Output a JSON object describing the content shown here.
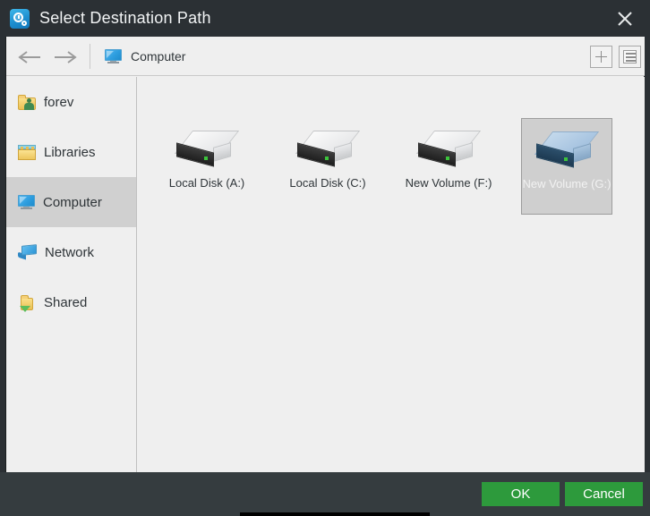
{
  "window": {
    "title": "Select Destination Path",
    "icon": "app-clock-icon",
    "close_icon": "close-icon",
    "accent_green": "#2d9a3c",
    "titlebar_color": "#2b3034",
    "panel_color": "#efefef"
  },
  "navbar": {
    "back_icon": "arrow-left-icon",
    "forward_icon": "arrow-right-icon",
    "breadcrumb": {
      "icon": "computer-monitor-icon",
      "label": "Computer"
    },
    "new_folder_icon": "plus-icon",
    "list_view_icon": "list-view-icon"
  },
  "sidebar": {
    "items": [
      {
        "label": "forev",
        "icon": "user-folder-icon",
        "selected": false
      },
      {
        "label": "Libraries",
        "icon": "libraries-icon",
        "selected": false
      },
      {
        "label": "Computer",
        "icon": "computer-monitor-icon",
        "selected": true
      },
      {
        "label": "Network",
        "icon": "network-icon",
        "selected": false
      },
      {
        "label": "Shared",
        "icon": "shared-folder-icon",
        "selected": false
      }
    ]
  },
  "files": {
    "items": [
      {
        "label": "Local Disk (A:)",
        "icon": "drive-icon",
        "selected": false
      },
      {
        "label": "Local Disk (C:)",
        "icon": "drive-icon",
        "selected": false
      },
      {
        "label": "New Volume (F:)",
        "icon": "drive-icon",
        "selected": false
      },
      {
        "label": "New Volume (G:)",
        "icon": "drive-icon",
        "selected": true
      }
    ]
  },
  "footer": {
    "ok_label": "OK",
    "cancel_label": "Cancel"
  }
}
